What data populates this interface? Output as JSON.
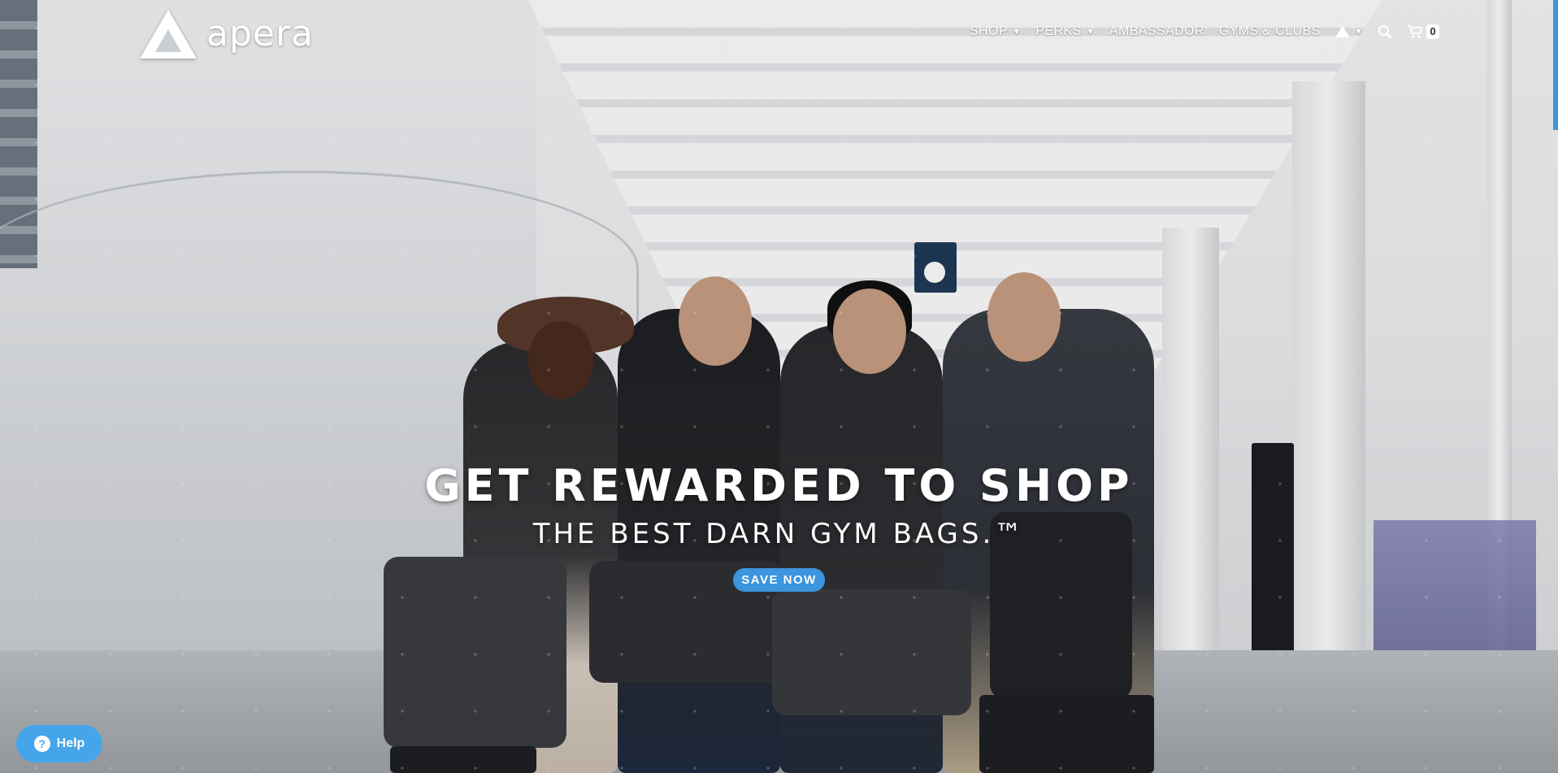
{
  "brand": {
    "name": "apera"
  },
  "nav": {
    "items": [
      {
        "label": "SHOP",
        "has_dropdown": true
      },
      {
        "label": "PERKS",
        "has_dropdown": true
      },
      {
        "label": "AMBASSADOR",
        "has_dropdown": false
      },
      {
        "label": "GYMS & CLUBS",
        "has_dropdown": false
      }
    ],
    "cart_count": "0",
    "icons": [
      "apera-account-icon",
      "search-icon",
      "cart-icon"
    ]
  },
  "hero": {
    "headline": "GET REWARDED TO SHOP",
    "subheadline": "THE BEST DARN GYM BAGS.™",
    "cta_label": "SAVE NOW"
  },
  "help": {
    "label": "Help"
  },
  "colors": {
    "accent": "#3c95dd",
    "help": "#45a5ea",
    "text": "#ffffff"
  }
}
